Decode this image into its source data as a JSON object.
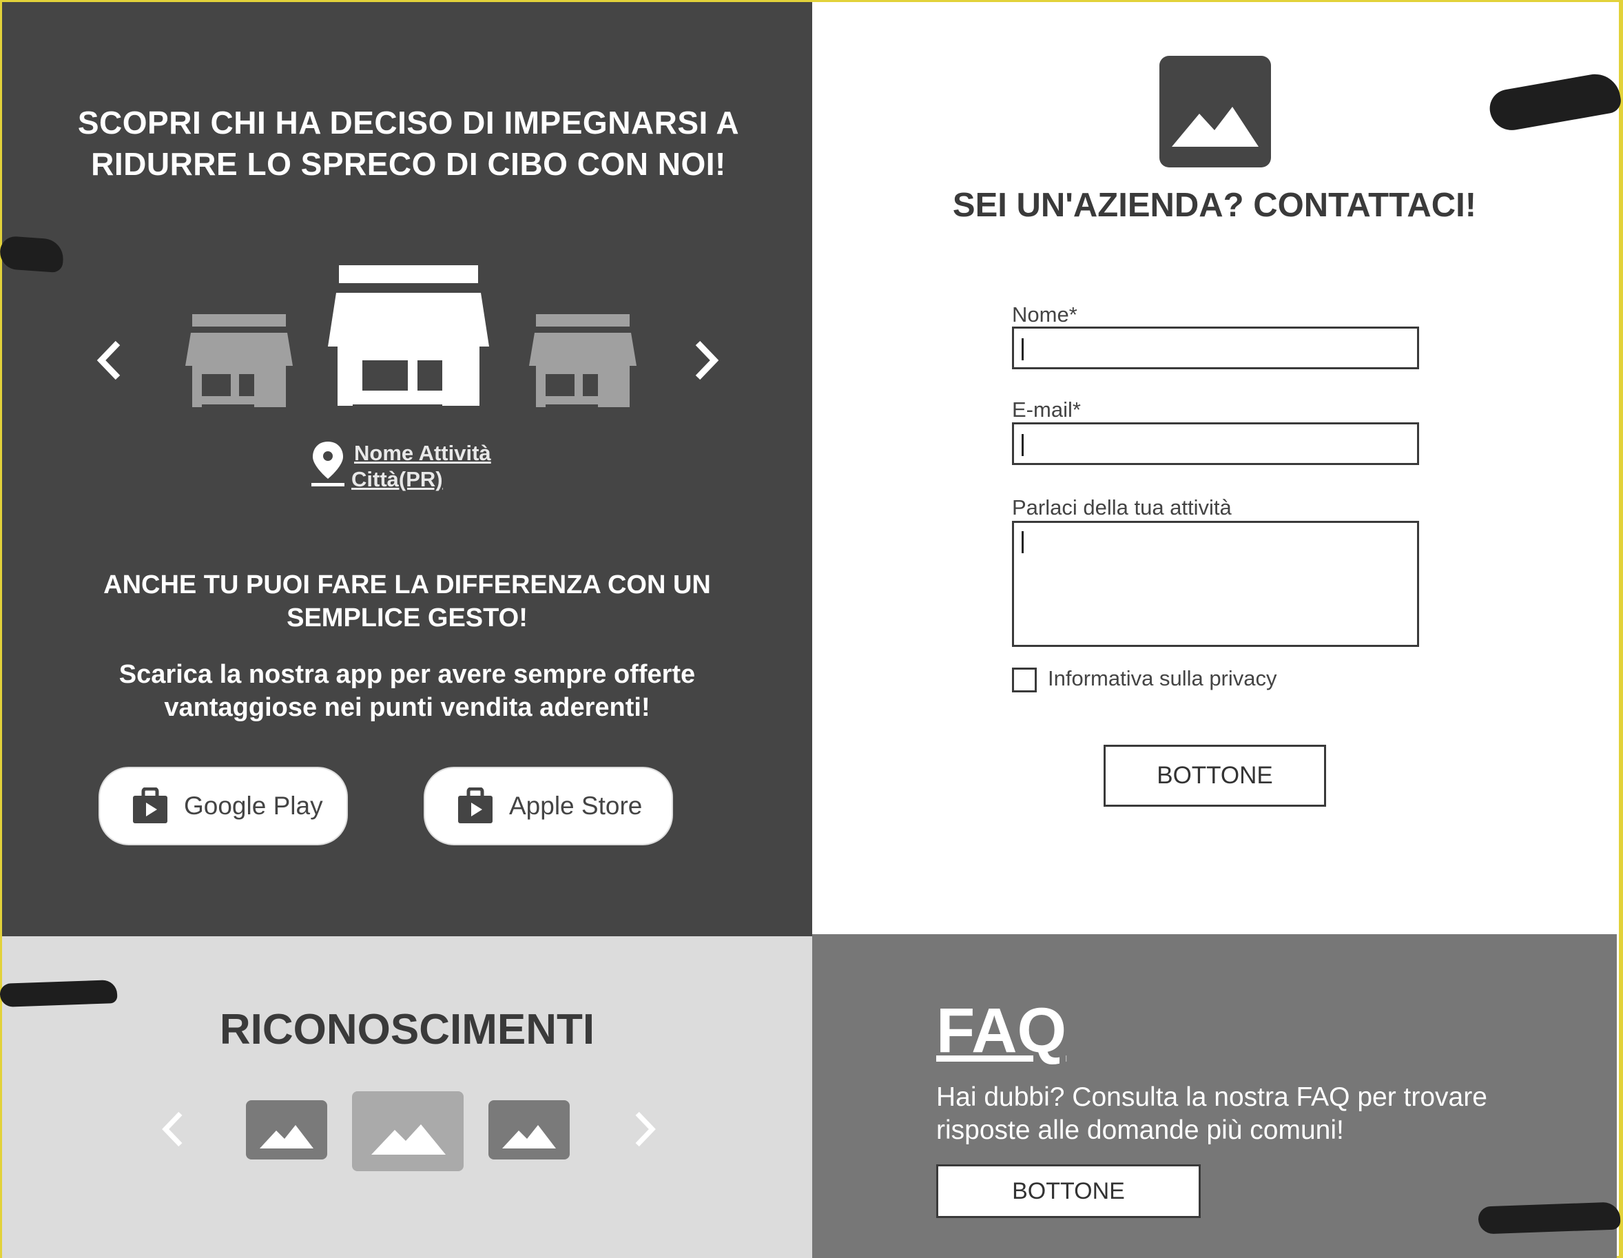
{
  "stores": {
    "heading": "SCOPRI CHI HA DECISO DI IMPEGNARSI A RIDURRE LO SPRECO DI CIBO CON NOI!",
    "store_name": "Nome Attività",
    "store_city": "Città(PR)",
    "cta_heading": "ANCHE TU PUOI FARE LA DIFFERENZA CON UN SEMPLICE GESTO!",
    "cta_text": "Scarica la nostra app per avere sempre offerte vantaggiose nei punti vendita aderenti!",
    "google_play_label": "Google Play",
    "apple_store_label": "Apple Store"
  },
  "contact": {
    "heading": "SEI UN'AZIENDA? CONTATTACI!",
    "name_label": "Nome*",
    "email_label": "E-mail*",
    "message_label": "Parlaci della tua attività",
    "privacy_label": "Informativa sulla privacy",
    "submit_label": "BOTTONE"
  },
  "awards": {
    "heading": "RICONOSCIMENTI"
  },
  "faq": {
    "heading": "FAQ",
    "text": "Hai dubbi? Consulta la nostra FAQ per trovare risposte alle domande più comuni!",
    "button_label": "BOTTONE"
  },
  "icons": {
    "prev": "chevron-left-icon",
    "next": "chevron-right-icon",
    "store": "store-icon",
    "pin": "map-pin-icon",
    "bag": "shopping-bag-icon",
    "image": "image-placeholder-icon"
  },
  "colors": {
    "dark_panel": "#454545",
    "light_panel": "#dcdcdc",
    "faq_panel": "#777777",
    "store_inactive": "#a0a0a0",
    "frame": "#e2d23a"
  }
}
